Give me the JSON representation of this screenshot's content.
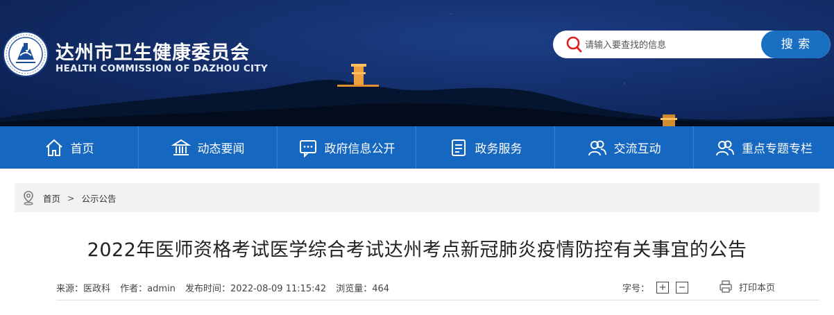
{
  "header": {
    "title": "达州市卫生健康委员会",
    "subtitle": "HEALTH COMMISSION OF DAZHOU CITY",
    "logo": "emblem-logo",
    "search": {
      "placeholder": "请输入要查找的信息",
      "button_label": "搜 索",
      "icon": "search-icon"
    }
  },
  "nav": {
    "items": [
      {
        "label": "首页",
        "icon": "home-icon"
      },
      {
        "label": "动态要闻",
        "icon": "building-icon"
      },
      {
        "label": "政府信息公开",
        "icon": "chat-icon"
      },
      {
        "label": "政务服务",
        "icon": "document-icon"
      },
      {
        "label": "交流互动",
        "icon": "users-icon"
      },
      {
        "label": "重点专题专栏",
        "icon": "users-icon"
      }
    ]
  },
  "breadcrumb": {
    "icon": "location-pin-icon",
    "home": "首页",
    "separator": ">",
    "current": "公示公告"
  },
  "article": {
    "title": "2022年医师资格考试医学综合考试达州考点新冠肺炎疫情防控有关事宜的公告",
    "meta": {
      "source": "来源：医政科",
      "author": "作者：admin",
      "published": "发布时间：2022-08-09 11:15:42",
      "views": "浏览量：464"
    },
    "font_size_label": "字号：",
    "increase_label": "+",
    "decrease_label": "−",
    "print_label": "打印本页"
  },
  "colors": {
    "nav_bg": "#1667c0",
    "accent": "#1a6fc3",
    "search_icon": "#e02020",
    "banner_dark": "#0a1e4a"
  }
}
